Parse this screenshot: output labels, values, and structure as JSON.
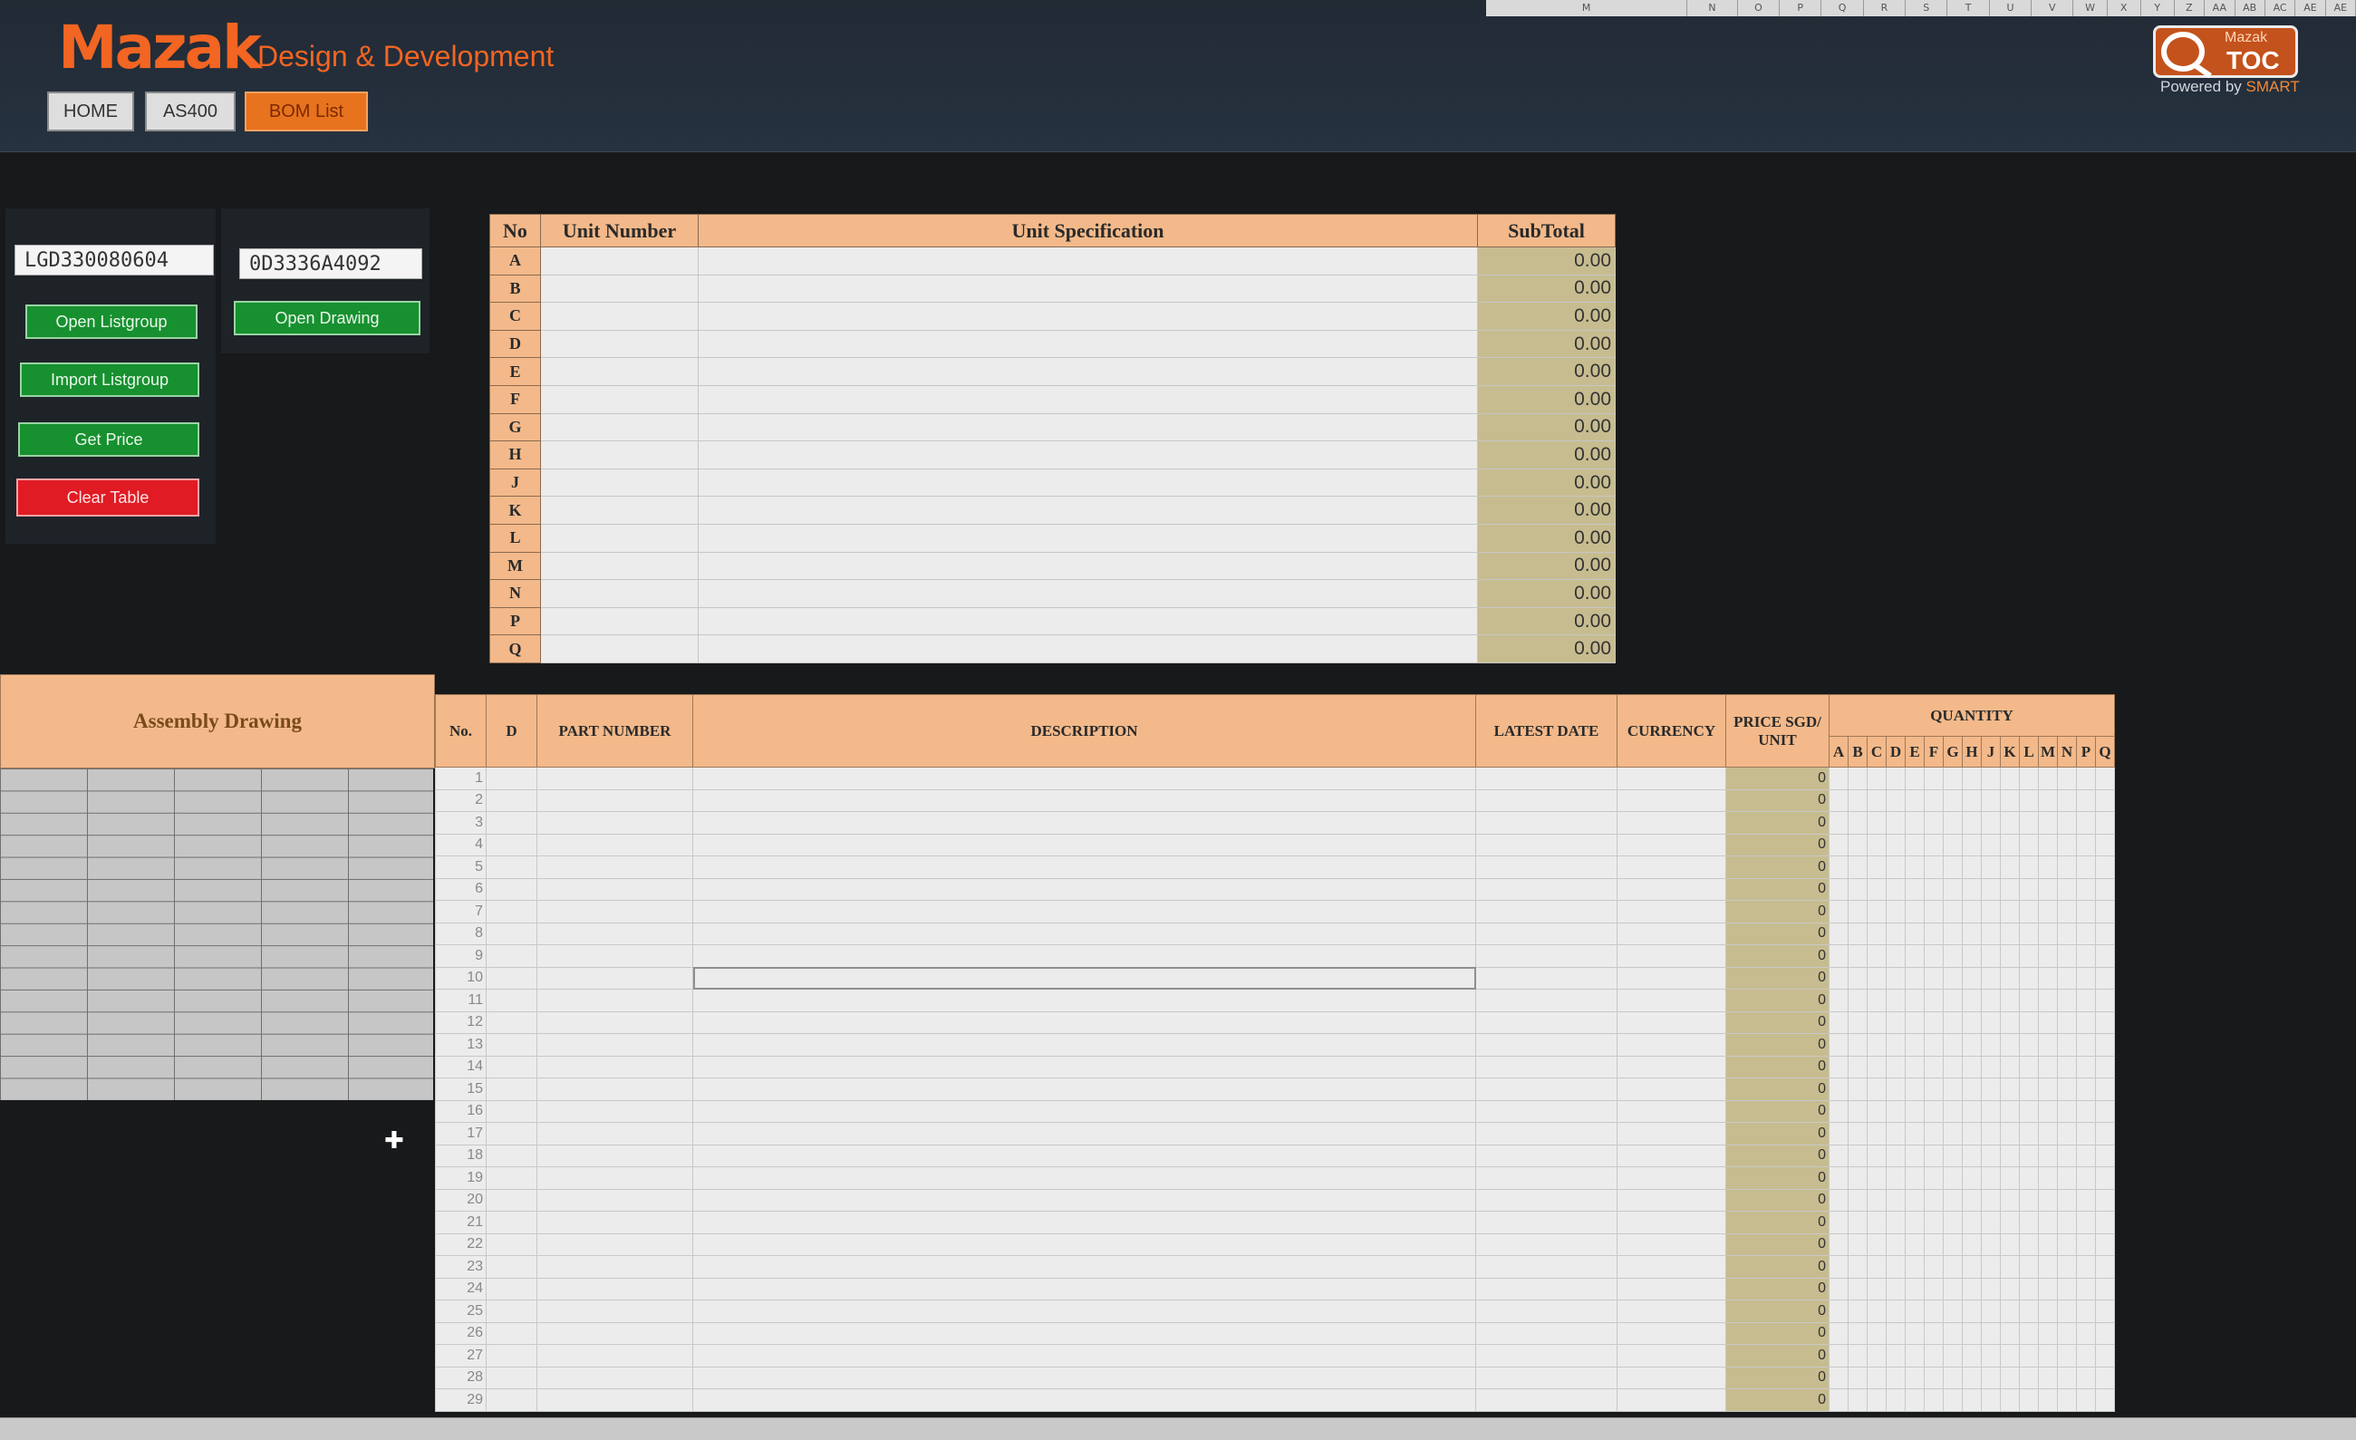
{
  "header": {
    "logo": "Mazak",
    "logo_subtitle": "Design & Development",
    "nav": {
      "home": "HOME",
      "as400": "AS400",
      "bom_list": "BOM List"
    },
    "badge": {
      "line1": "Mazak",
      "line2": "TOC"
    },
    "powered_by": "Powered by",
    "powered_brand": "SMART"
  },
  "column_strip": [
    "M",
    "N",
    "O",
    "P",
    "Q",
    "R",
    "S",
    "T",
    "U",
    "V",
    "W",
    "X",
    "Y",
    "Z",
    "AA",
    "AB",
    "AC",
    "AE",
    "AE"
  ],
  "panel": {
    "listgroup_id": "LGD330080604",
    "drawing_id": "0D3336A4092",
    "open_listgroup": "Open Listgroup",
    "open_drawing": "Open Drawing",
    "import_listgroup": "Import Listgroup",
    "get_price": "Get Price",
    "clear_table": "Clear Table"
  },
  "unit_table": {
    "headers": {
      "no": "No",
      "unit_number": "Unit Number",
      "unit_spec": "Unit Specification",
      "subtotal": "SubTotal"
    },
    "rows": [
      {
        "no": "A",
        "subtotal": "0.00"
      },
      {
        "no": "B",
        "subtotal": "0.00"
      },
      {
        "no": "C",
        "subtotal": "0.00"
      },
      {
        "no": "D",
        "subtotal": "0.00"
      },
      {
        "no": "E",
        "subtotal": "0.00"
      },
      {
        "no": "F",
        "subtotal": "0.00"
      },
      {
        "no": "G",
        "subtotal": "0.00"
      },
      {
        "no": "H",
        "subtotal": "0.00"
      },
      {
        "no": "J",
        "subtotal": "0.00"
      },
      {
        "no": "K",
        "subtotal": "0.00"
      },
      {
        "no": "L",
        "subtotal": "0.00"
      },
      {
        "no": "M",
        "subtotal": "0.00"
      },
      {
        "no": "N",
        "subtotal": "0.00"
      },
      {
        "no": "P",
        "subtotal": "0.00"
      },
      {
        "no": "Q",
        "subtotal": "0.00"
      }
    ]
  },
  "bom_table": {
    "assembly_drawing": "Assembly Drawing",
    "headers": {
      "no": "No.",
      "d": "D",
      "part_number": "PART NUMBER",
      "description": "DESCRIPTION",
      "latest_date": "LATEST DATE",
      "currency": "CURRENCY",
      "price": "PRICE SGD/ UNIT",
      "quantity": "QUANTITY"
    },
    "quantity_columns": [
      "A",
      "B",
      "C",
      "D",
      "E",
      "F",
      "G",
      "H",
      "J",
      "K",
      "L",
      "M",
      "N",
      "P",
      "Q"
    ],
    "row_numbers": [
      "1",
      "2",
      "3",
      "4",
      "5",
      "6",
      "7",
      "8",
      "9",
      "10",
      "11",
      "12",
      "13",
      "14",
      "15",
      "16",
      "17",
      "18",
      "19",
      "20",
      "21",
      "22",
      "23",
      "24",
      "25",
      "26",
      "27",
      "28",
      "29"
    ],
    "price_value": "0"
  }
}
